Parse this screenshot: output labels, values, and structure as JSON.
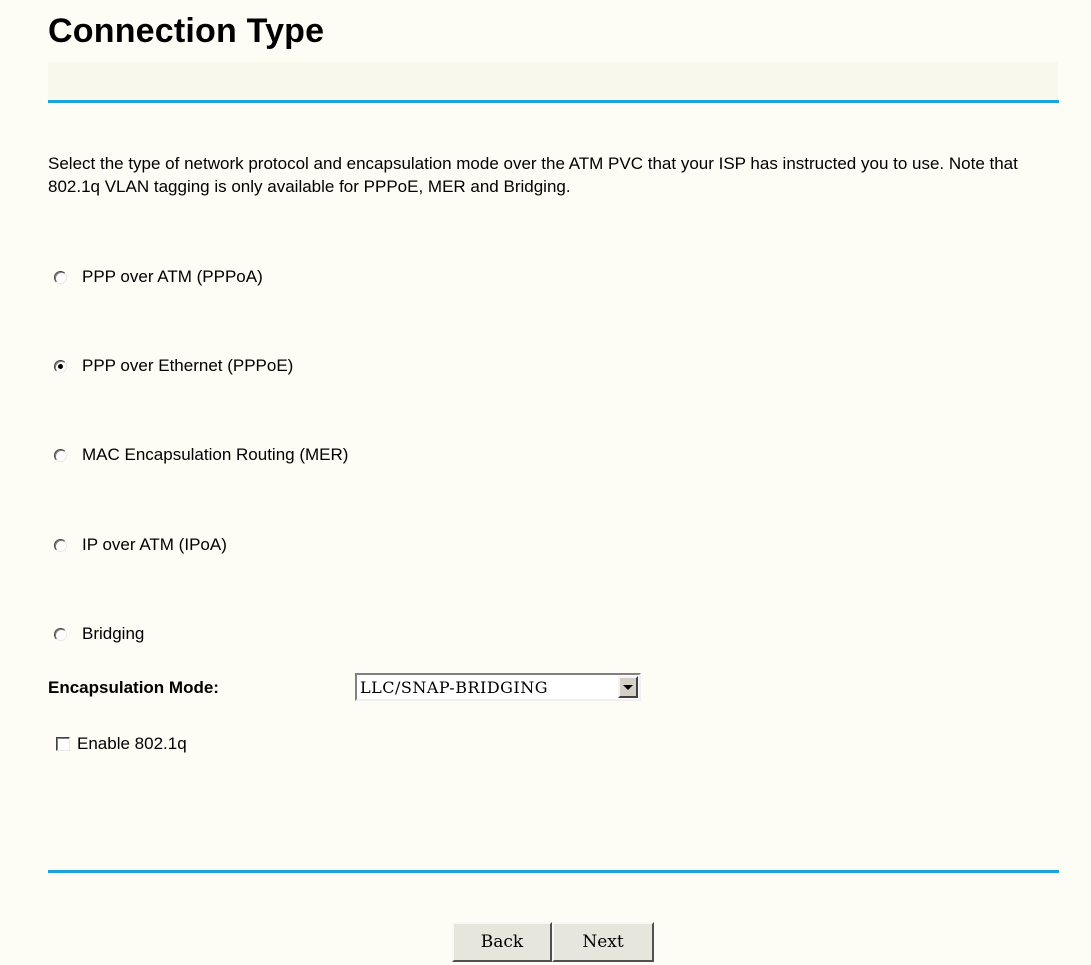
{
  "header": {
    "title": "Connection Type"
  },
  "description": "Select the type of network protocol and encapsulation mode over the ATM PVC that your ISP has instructed you to use. Note that 802.1q VLAN tagging is only available for PPPoE, MER and Bridging.",
  "connection_types": [
    {
      "label": "PPP over ATM (PPPoA)",
      "checked": false
    },
    {
      "label": "PPP over Ethernet (PPPoE)",
      "checked": true
    },
    {
      "label": "MAC Encapsulation Routing (MER)",
      "checked": false
    },
    {
      "label": "IP over ATM (IPoA)",
      "checked": false
    },
    {
      "label": "Bridging",
      "checked": false
    }
  ],
  "encapsulation": {
    "label": "Encapsulation Mode:",
    "selected": "LLC/SNAP-BRIDGING"
  },
  "vlan": {
    "label": "Enable 802.1q",
    "checked": false
  },
  "buttons": {
    "back": "Back",
    "next": "Next"
  },
  "colors": {
    "accent_rule": "#1ca3d9",
    "background": "#fdfdf5"
  }
}
